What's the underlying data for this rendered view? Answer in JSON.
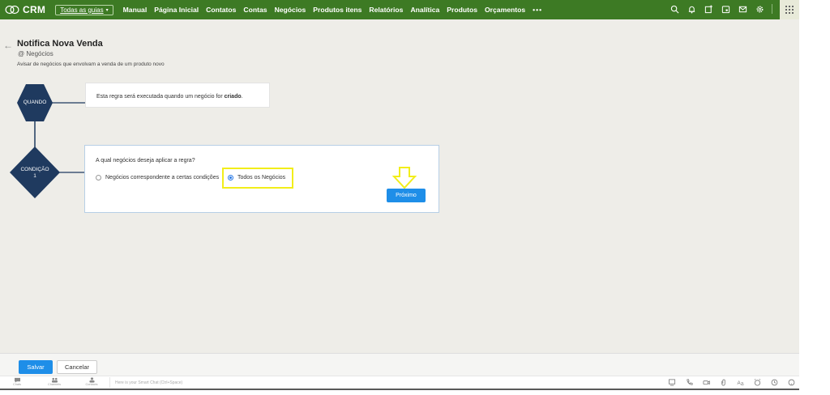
{
  "app": {
    "name": "CRM",
    "all_tabs_label": "Todas as guias",
    "nav": [
      "Manual",
      "Página Inicial",
      "Contatos",
      "Contas",
      "Negócios",
      "Produtos itens",
      "Relatórios",
      "Analítica",
      "Produtos",
      "Orçamentos"
    ],
    "more_label": "•••",
    "brand_color": "#3d7a24"
  },
  "rule": {
    "title": "Notifica Nova Venda",
    "module": "@ Negócios",
    "description": "Avisar de negócios que envolvam a venda de um produto novo",
    "when_node": "QUANDO",
    "when_text_prefix": "Esta regra será executada quando um negócio for ",
    "when_text_bold": "criado",
    "when_text_suffix": ".",
    "condition_node_line1": "CONDIÇÃO",
    "condition_node_line2": "1",
    "condition_question": "A qual negócios deseja aplicar a regra?",
    "option_conditions": "Negócios correspondente a certas condições",
    "option_all": "Todos os Negócios",
    "selected_option": "Todos os Negócios",
    "next_button": "Próximo",
    "node_color": "#1f3a5f",
    "highlight_color": "#f2ee1a"
  },
  "footer": {
    "save_label": "Salvar",
    "cancel_label": "Cancelar"
  },
  "chatbar": {
    "tabs": [
      "Chats",
      "Channels",
      "Contacts"
    ],
    "placeholder": "Here is your Smart Chat (Ctrl+Space)"
  }
}
